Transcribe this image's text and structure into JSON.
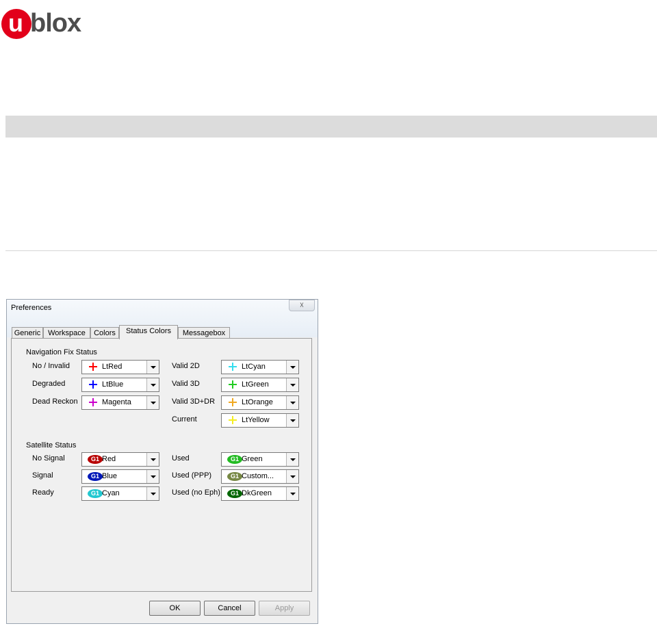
{
  "logo": {
    "mark": "u",
    "text": "blox",
    "brand_color": "#e2001a"
  },
  "dialog": {
    "title": "Preferences",
    "close_glyph": "☓",
    "tabs": [
      {
        "label": "Generic"
      },
      {
        "label": "Workspace"
      },
      {
        "label": "Colors"
      },
      {
        "label": "Status Colors",
        "active": true
      },
      {
        "label": "Messagebox"
      }
    ],
    "nav_fix": {
      "group_label": "Navigation Fix Status",
      "left": [
        {
          "label": "No / Invalid",
          "value": "LtRed",
          "color": "#ff0000"
        },
        {
          "label": "Degraded",
          "value": "LtBlue",
          "color": "#0000ff"
        },
        {
          "label": "Dead Reckon",
          "value": "Magenta",
          "color": "#cc00cc"
        }
      ],
      "right": [
        {
          "label": "Valid 2D",
          "value": "LtCyan",
          "color": "#33ddee"
        },
        {
          "label": "Valid 3D",
          "value": "LtGreen",
          "color": "#22cc22"
        },
        {
          "label": "Valid 3D+DR",
          "value": "LtOrange",
          "color": "#f0a820"
        },
        {
          "label": "Current",
          "value": "LtYellow",
          "color": "#f4ee22"
        }
      ]
    },
    "satellite": {
      "group_label": "Satellite Status",
      "badge_text": "G1",
      "left": [
        {
          "label": "No Signal",
          "value": "Red",
          "color": "#b80000"
        },
        {
          "label": "Signal",
          "value": "Blue",
          "color": "#0018b8"
        },
        {
          "label": "Ready",
          "value": "Cyan",
          "color": "#22c8d0"
        }
      ],
      "right": [
        {
          "label": "Used",
          "value": "Green",
          "color": "#22bb22"
        },
        {
          "label": "Used (PPP)",
          "value": "Custom...",
          "color": "#778844"
        },
        {
          "label": "Used (no Eph)",
          "value": "DkGreen",
          "color": "#006600"
        }
      ]
    },
    "buttons": {
      "ok": "OK",
      "cancel": "Cancel",
      "apply": "Apply"
    }
  }
}
